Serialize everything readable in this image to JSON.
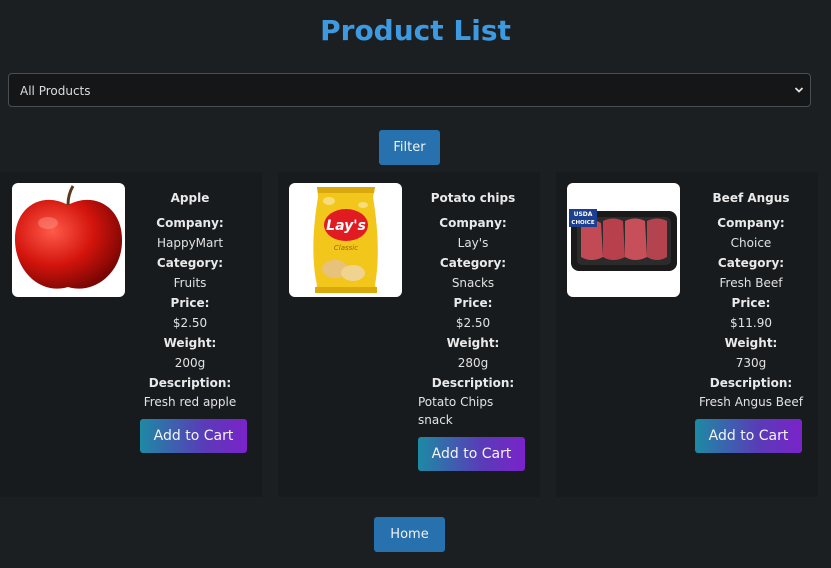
{
  "header": {
    "title": "Product List"
  },
  "filter": {
    "selected": "All Products",
    "button_label": "Filter"
  },
  "labels": {
    "company": "Company:",
    "category": "Category:",
    "price": "Price:",
    "weight": "Weight:",
    "description": "Description:",
    "add_to_cart": "Add to Cart"
  },
  "products": [
    {
      "name": "Apple",
      "company": "HappyMart",
      "category": "Fruits",
      "price": "$2.50",
      "weight": "200g",
      "description": "Fresh red apple",
      "image_icon": "apple-image"
    },
    {
      "name": "Potato chips",
      "company": "Lay's",
      "category": "Snacks",
      "price": "$2.50",
      "weight": "280g",
      "description": "Potato Chips snack",
      "image_icon": "chips-bag-image",
      "brand_text": "Lay's",
      "brand_sub": "Classic"
    },
    {
      "name": "Beef Angus",
      "company": "Choice",
      "category": "Fresh Beef",
      "price": "$11.90",
      "weight": "730g",
      "description": "Fresh Angus Beef",
      "image_icon": "beef-tray-image",
      "badge_text_1": "USDA",
      "badge_text_2": "CHOICE"
    }
  ],
  "footer": {
    "home_label": "Home"
  },
  "colors": {
    "accent": "#3d9ae0",
    "button": "#2671ae",
    "card_bg": "#181b1e",
    "page_bg": "#1c1f22"
  }
}
